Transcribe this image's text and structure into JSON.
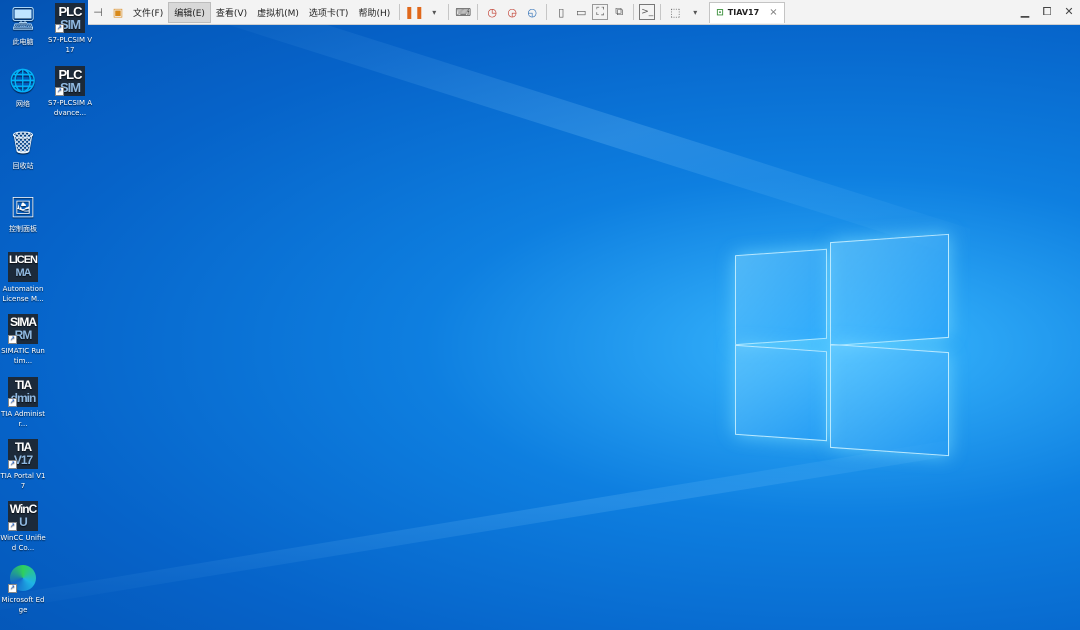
{
  "toolbar": {
    "menu": [
      "文件(F)",
      "编辑(E)",
      "查看(V)",
      "虚拟机(M)",
      "选项卡(T)",
      "帮助(H)"
    ],
    "active_menu_index": 1,
    "tab_title": "TIAV17",
    "tab_close": "×",
    "icons": [
      "pin-icon",
      "vm-icon",
      "pause-icon",
      "dropdown-icon",
      "send-keys-icon",
      "snapshot-icon",
      "revert-snapshot-icon",
      "snapshot-manager-icon",
      "view-single-icon",
      "view-thumbnail-icon",
      "fullscreen-icon",
      "unity-icon",
      "console-icon",
      "stretch-icon"
    ]
  },
  "desktop": {
    "icons": [
      {
        "label": "此电脑",
        "glyph": "🖥",
        "kind": "system"
      },
      {
        "label": "S7-PLCSIM V17",
        "glyph_main": "PLC",
        "glyph_sub": "SIM",
        "kind": "app"
      },
      {
        "label": "网络",
        "glyph": "🌐",
        "kind": "system"
      },
      {
        "label": "S7-PLCSIM Advance...",
        "glyph_main": "PLC",
        "glyph_sub": "SIM",
        "kind": "app"
      },
      {
        "label": "回收站",
        "glyph": "🗑",
        "kind": "system"
      },
      {
        "label": "控制面板",
        "glyph": "🖼",
        "kind": "system"
      },
      {
        "label": "Automation License M...",
        "glyph_main": "LICEN",
        "glyph_sub": "MA",
        "kind": "app"
      },
      {
        "label": "SIMATIC Runtim...",
        "glyph_main": "SIMA",
        "glyph_sub": "RM",
        "kind": "app"
      },
      {
        "label": "TIA Administr...",
        "glyph_main": "TIA",
        "glyph_sub": "dmin",
        "kind": "app"
      },
      {
        "label": "TIA Portal V17",
        "glyph_main": "TIA",
        "glyph_sub": "V17",
        "kind": "app"
      },
      {
        "label": "WinCC Unified Co...",
        "glyph_main": "WinC",
        "glyph_sub": "U",
        "kind": "app"
      },
      {
        "label": "Microsoft Edge",
        "glyph": "◐",
        "kind": "system"
      }
    ]
  },
  "colors": {
    "accent": "#0e7fe0",
    "pause": "#e0681b"
  }
}
